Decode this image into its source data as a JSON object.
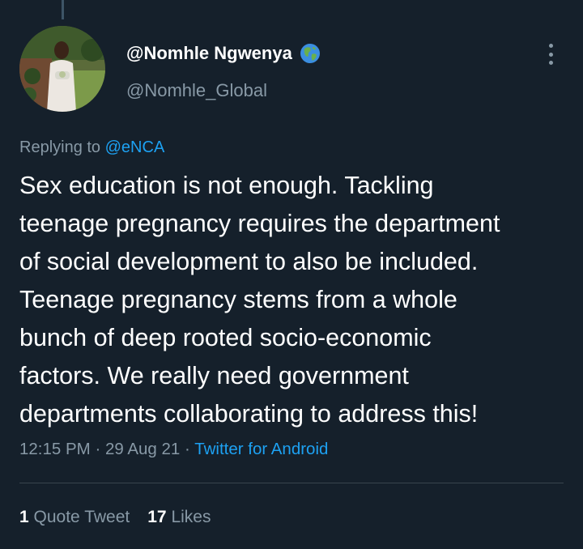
{
  "author": {
    "display_name": "@Nomhle Ngwenya",
    "handle": "@Nomhle_Global",
    "name_emoji_icon": "globe-earth-americas-icon"
  },
  "reply": {
    "prefix": "Replying to",
    "mention": "@eNCA"
  },
  "tweet": {
    "lines": [
      "Sex education is not enough. Tackling",
      "teenage pregnancy requires the department",
      "of social development to also be included.",
      "Teenage pregnancy stems from a whole",
      "bunch of deep rooted socio-economic",
      "factors. We really need government",
      "departments collaborating to address this!"
    ]
  },
  "meta": {
    "time": "12:15 PM",
    "separator": "·",
    "date": "29 Aug 21",
    "source": "Twitter for Android"
  },
  "stats": {
    "quote_count": "1",
    "quote_label": "Quote Tweet",
    "likes_count": "17",
    "likes_label": "Likes"
  },
  "colors": {
    "background": "#15202b",
    "text": "#ffffff",
    "secondary": "#8899a6",
    "accent": "#1da1f2",
    "divider": "#38444d"
  }
}
